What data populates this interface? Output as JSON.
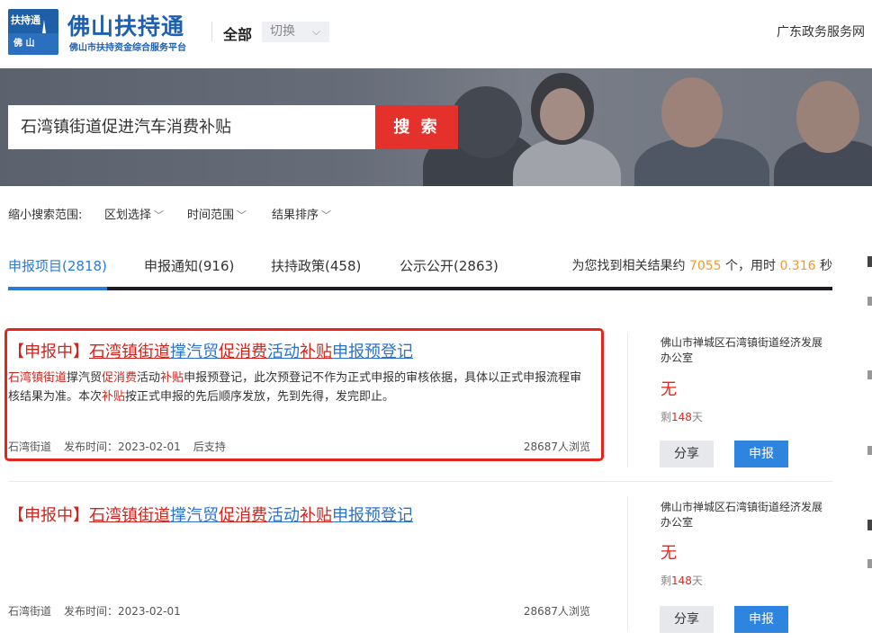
{
  "header": {
    "logo_badge_top": "扶持通",
    "logo_badge_bottom": "佛 山",
    "logo_title": "佛山扶持通",
    "logo_subtitle": "佛山市扶持资金综合服务平台",
    "scope_label": "全部",
    "switch_label": "切换",
    "gov_link": "广东政务服务网"
  },
  "search": {
    "query": "石湾镇街道促进汽车消费补贴",
    "button_label": "搜 索"
  },
  "filters": {
    "label": "缩小搜索范围:",
    "region": "区划选择",
    "time": "时间范围",
    "sort": "结果排序"
  },
  "tabs": [
    {
      "label": "申报项目(2818)",
      "active": true
    },
    {
      "label": "申报通知(916)",
      "active": false
    },
    {
      "label": "扶持政策(458)",
      "active": false
    },
    {
      "label": "公示公开(2863)",
      "active": false
    }
  ],
  "results_info": {
    "prefix": "为您找到相关结果约",
    "count": "7055",
    "mid": "个，用时",
    "time": "0.316",
    "suffix": "秒"
  },
  "results": [
    {
      "status": "【申报中】",
      "title_parts": [
        "石湾镇街道",
        "撑汽贸",
        "促消费",
        "活动",
        "补贴",
        "申报预登记"
      ],
      "desc_parts": [
        "石湾镇街道",
        "撑汽贸",
        "促消费",
        "活动",
        "补贴",
        "申报预登记，此次预登记不作为正式申报的审核依据，具体以正式申报流程审核结果为准。本次",
        "补贴",
        "按正式申报的先后顺序发放，先到先得，发完即止。"
      ],
      "meta": [
        "石湾街道",
        "发布时间：2023-02-01",
        "后支持"
      ],
      "views": "28687人浏览",
      "org": "佛山市禅城区石湾镇街道经济发展办公室",
      "amount": "无",
      "remain_prefix": "剩",
      "remain_days": "148",
      "remain_suffix": "天",
      "share_label": "分享",
      "apply_label": "申报"
    },
    {
      "status": "【申报中】",
      "title_parts": [
        "石湾镇街道",
        "撑汽贸",
        "促消费",
        "活动",
        "补贴",
        "申报预登记"
      ],
      "meta": [
        "石湾街道",
        "发布时间：2023-02-01"
      ],
      "views": "28687人浏览",
      "org": "佛山市禅城区石湾镇街道经济发展办公室",
      "amount": "无",
      "remain_prefix": "剩",
      "remain_days": "148",
      "remain_suffix": "天",
      "share_label": "分享",
      "apply_label": "申报"
    }
  ],
  "colors": {
    "brand_blue": "#1d5fb0",
    "search_red": "#e4312b",
    "link_blue": "#2d72c9",
    "highlight_red": "#d2231c",
    "apply_blue": "#2d85e0",
    "stat_orange": "#f29a2e"
  },
  "icons": {
    "logo": "tower-logo-icon",
    "dropdown": "chevron-down-icon"
  }
}
